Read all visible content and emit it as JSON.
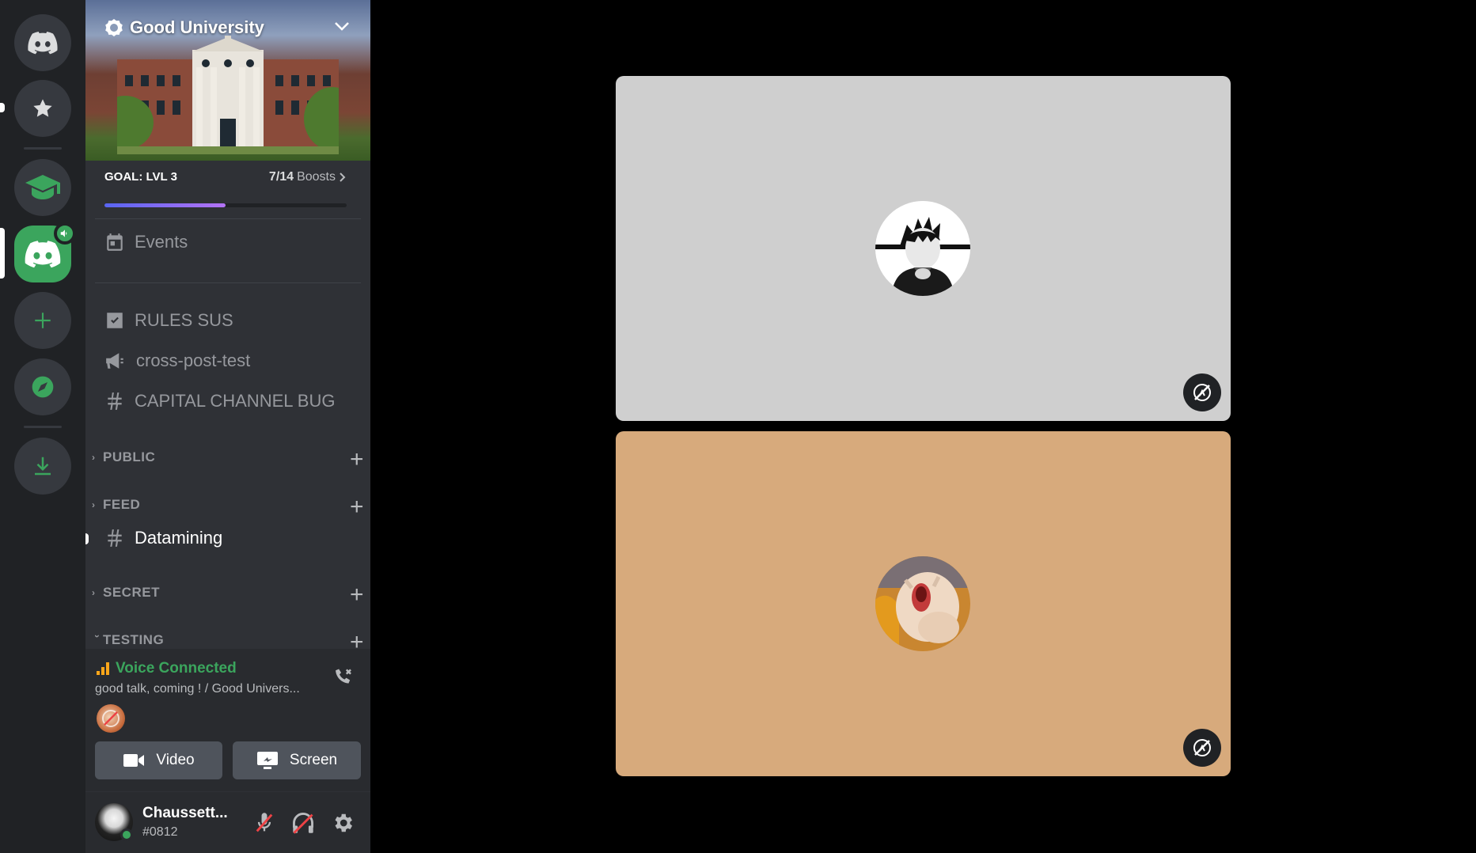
{
  "server": {
    "name": "Good University",
    "boost": {
      "goal_label": "GOAL: LVL 3",
      "count_current": "7",
      "count_total": "/14",
      "count_suffix": "Boosts",
      "progress": 0.5
    }
  },
  "channels": {
    "events_label": "Events",
    "top": [
      {
        "name": "RULES SUS",
        "icon": "rules-icon"
      },
      {
        "name": "cross-post-test",
        "icon": "megaphone-icon"
      },
      {
        "name": "CAPITAL CHANNEL BUG",
        "icon": "hash-icon"
      }
    ],
    "categories": [
      {
        "name": "PUBLIC",
        "collapsed": true
      },
      {
        "name": "FEED",
        "collapsed": true
      },
      {
        "name": "SECRET",
        "collapsed": true
      },
      {
        "name": "TESTING",
        "collapsed": false
      }
    ],
    "active_channel": {
      "name": "Datamining",
      "icon": "hash-icon"
    }
  },
  "voice": {
    "status": "Voice Connected",
    "location": "good talk, coming ! / Good Univers...",
    "video_label": "Video",
    "screen_label": "Screen"
  },
  "user": {
    "name": "Chaussett...",
    "tag": "#0812"
  },
  "colors": {
    "green": "#3ba55d",
    "tile_top_bg": "#cfcfcf",
    "tile_bottom_bg": "#d7aa7c",
    "boost_fill": "#5865f2",
    "muted_red": "#ed4245"
  }
}
